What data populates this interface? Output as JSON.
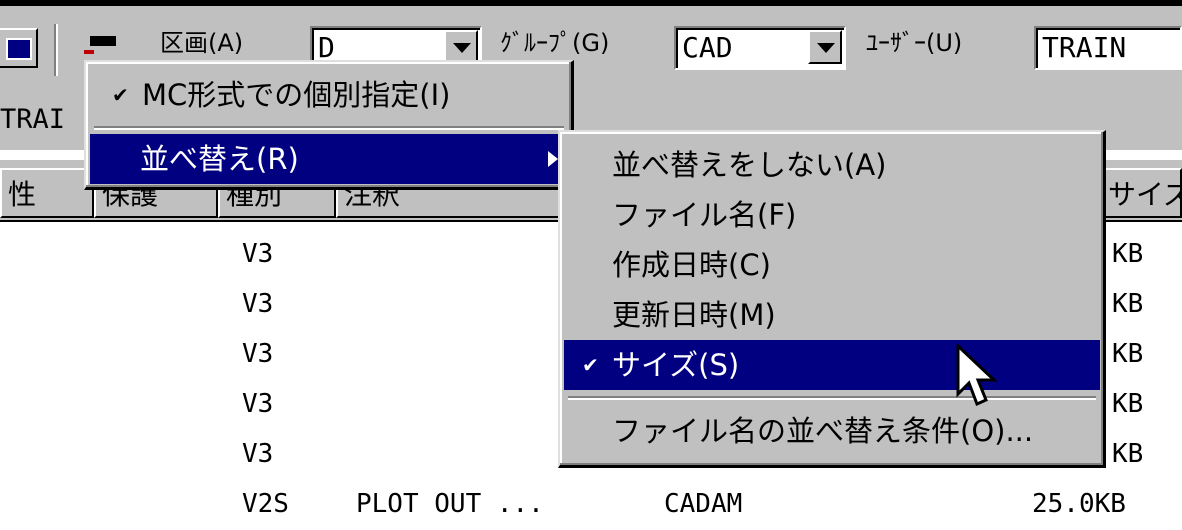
{
  "toolbar": {
    "drawing_label": "区画(A)",
    "drawing_value": "D",
    "group_label": "ｸﾞﾙｰﾌﾟ(G)",
    "group_value": "CAD",
    "user_label": "ﾕｰｻﾞｰ(U)",
    "user_value": "TRAIN"
  },
  "path": {
    "text": "TRAI"
  },
  "columns": [
    "性",
    "保護",
    "種別",
    "注釈",
    "サイズ"
  ],
  "rows": [
    {
      "type": "V3",
      "size": "KB"
    },
    {
      "type": "V3",
      "size": "KB"
    },
    {
      "type": "V3",
      "size": "KB"
    },
    {
      "type": "V3",
      "size": "KB"
    },
    {
      "type": "V3",
      "size": "KB"
    },
    {
      "type": "V2S",
      "comment": "PLOT OUT ...",
      "kind": "CADAM",
      "size": "25.0KB"
    }
  ],
  "main_menu": {
    "items": [
      {
        "label": "MC形式での個別指定(I)",
        "checked": true
      },
      {
        "label": "並べ替え(R)",
        "highlighted": true,
        "has_submenu": true
      }
    ]
  },
  "sort_menu": {
    "items": [
      {
        "label": "並べ替えをしない(A)"
      },
      {
        "label": "ファイル名(F)"
      },
      {
        "label": "作成日時(C)"
      },
      {
        "label": "更新日時(M)"
      },
      {
        "label": "サイズ(S)",
        "checked": true,
        "highlighted": true
      },
      {
        "label": "ファイル名の並べ替え条件(O)..."
      }
    ]
  },
  "colors": {
    "highlight": "#000080",
    "face": "#c0c0c0"
  }
}
